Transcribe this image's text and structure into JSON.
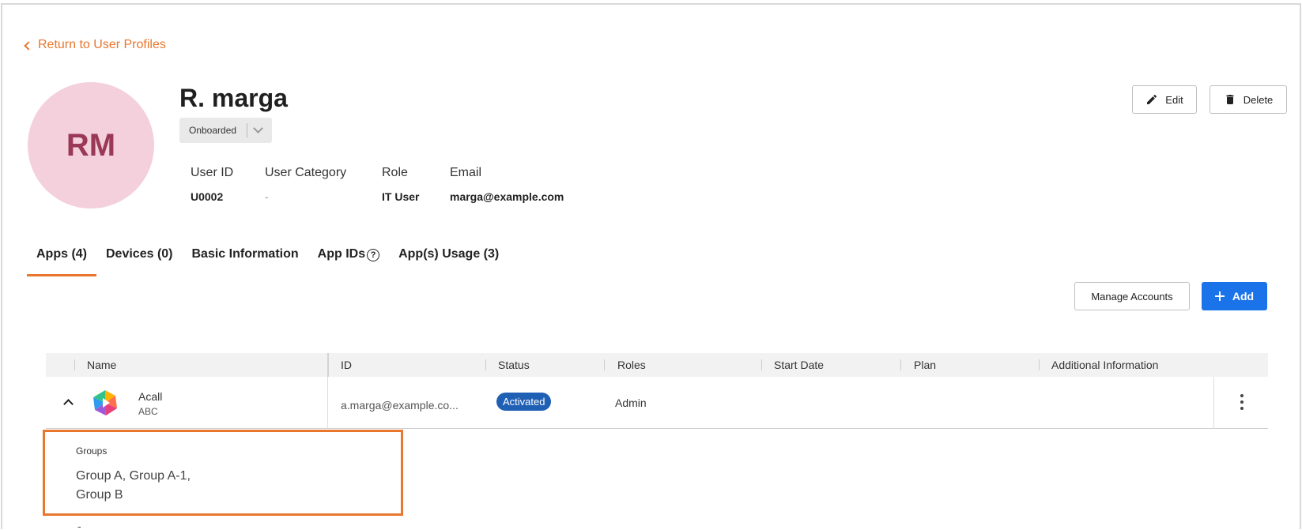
{
  "nav": {
    "back_label": "Return to User Profiles"
  },
  "profile": {
    "initials": "RM",
    "name": "R. marga",
    "status": "Onboarded",
    "fields": {
      "user_id_label": "User ID",
      "user_id": "U0002",
      "category_label": "User Category",
      "category": "-",
      "role_label": "Role",
      "role": "IT User",
      "email_label": "Email",
      "email": "marga@example.com"
    }
  },
  "actions": {
    "edit_label": "Edit",
    "delete_label": "Delete"
  },
  "tabs": [
    {
      "label": "Apps (4)"
    },
    {
      "label": "Devices (0)"
    },
    {
      "label": "Basic Information"
    },
    {
      "label": "App IDs"
    },
    {
      "label": "App(s) Usage (3)"
    }
  ],
  "toolbar": {
    "manage_label": "Manage Accounts",
    "add_label": "Add"
  },
  "table": {
    "columns": [
      "Name",
      "ID",
      "Status",
      "Roles",
      "Start Date",
      "Plan",
      "Additional Information"
    ],
    "rows": [
      {
        "name": "Acall",
        "sub": "ABC",
        "id": "a.marga@example.co...",
        "status": "Activated",
        "roles": "Admin"
      }
    ]
  },
  "expanded": {
    "groups_label": "Groups",
    "groups_value": "Group A, Group A-1, Group B"
  },
  "trailing_value": "-",
  "colors": {
    "accent": "#e8762c",
    "primary": "#1a73e8",
    "badge": "#1f5fb4",
    "avatar_bg": "#f4cfdc",
    "avatar_text": "#9a3858"
  },
  "icons": [
    "chevron-left-icon",
    "pencil-icon",
    "trash-icon",
    "question-circle-icon",
    "plus-icon",
    "chevron-up-icon",
    "kebab-icon"
  ]
}
